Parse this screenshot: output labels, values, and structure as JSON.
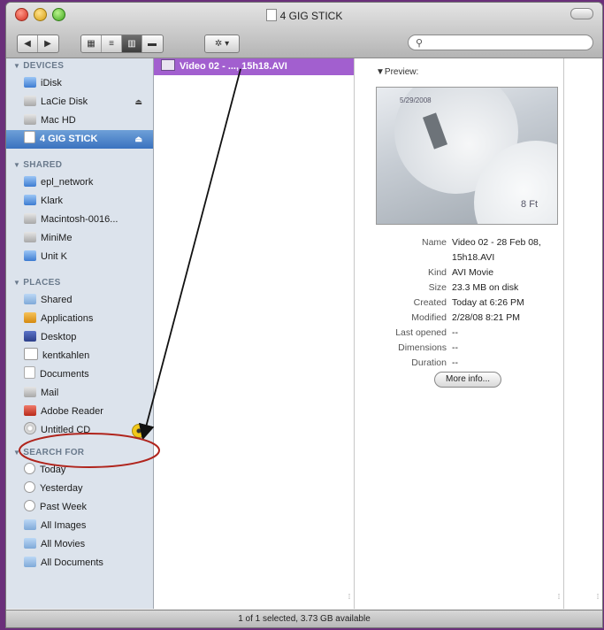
{
  "window": {
    "title": "4 GIG STICK",
    "status": "1 of 1 selected, 3.73 GB available"
  },
  "toolbar": {
    "back_glyph": "◀",
    "forward_glyph": "▶",
    "view_icons": [
      "icon-view-icon",
      "list-view-icon",
      "column-view-icon",
      "coverflow-view-icon"
    ],
    "action_glyph": "✲ ▾",
    "search_glyph": "⚲"
  },
  "sidebar": {
    "devices": {
      "header": "DEVICES",
      "items": [
        {
          "label": "iDisk"
        },
        {
          "label": "LaCie Disk"
        },
        {
          "label": "Mac HD"
        },
        {
          "label": "4 GIG STICK"
        }
      ]
    },
    "shared": {
      "header": "SHARED",
      "items": [
        {
          "label": "epl_network"
        },
        {
          "label": "Klark"
        },
        {
          "label": "Macintosh-0016..."
        },
        {
          "label": "MiniMe"
        },
        {
          "label": "Unit K"
        }
      ]
    },
    "places": {
      "header": "PLACES",
      "items": [
        {
          "label": "Shared"
        },
        {
          "label": "Applications"
        },
        {
          "label": "Desktop"
        },
        {
          "label": "kentkahlen"
        },
        {
          "label": "Documents"
        },
        {
          "label": "Mail"
        },
        {
          "label": "Adobe Reader"
        },
        {
          "label": "Untitled CD"
        }
      ]
    },
    "search_for": {
      "header": "SEARCH FOR",
      "items": [
        {
          "label": "Today"
        },
        {
          "label": "Yesterday"
        },
        {
          "label": "Past Week"
        },
        {
          "label": "All Images"
        },
        {
          "label": "All Movies"
        },
        {
          "label": "All Documents"
        }
      ]
    },
    "eject_glyph": "⏏"
  },
  "column": {
    "selected_file": "Video 02 - ..., 15h18.AVI"
  },
  "preview": {
    "label": "Preview:",
    "image_timestamp": "5/29/2008",
    "image_corner": "8 Ft",
    "rows": [
      {
        "key": "Name",
        "value": "Video 02 - 28 Feb 08, 15h18.AVI"
      },
      {
        "key": "Kind",
        "value": "AVI Movie"
      },
      {
        "key": "Size",
        "value": "23.3 MB on disk"
      },
      {
        "key": "Created",
        "value": "Today at 6:26 PM"
      },
      {
        "key": "Modified",
        "value": "2/28/08 8:21 PM"
      },
      {
        "key": "Last opened",
        "value": "--"
      },
      {
        "key": "Dimensions",
        "value": "--"
      },
      {
        "key": "Duration",
        "value": "--"
      }
    ],
    "more_info_label": "More info..."
  },
  "colors": {
    "selection_purple": "#a25fcf",
    "sidebar_selected": "#3a72bf",
    "annotation_red": "#b0241c"
  }
}
